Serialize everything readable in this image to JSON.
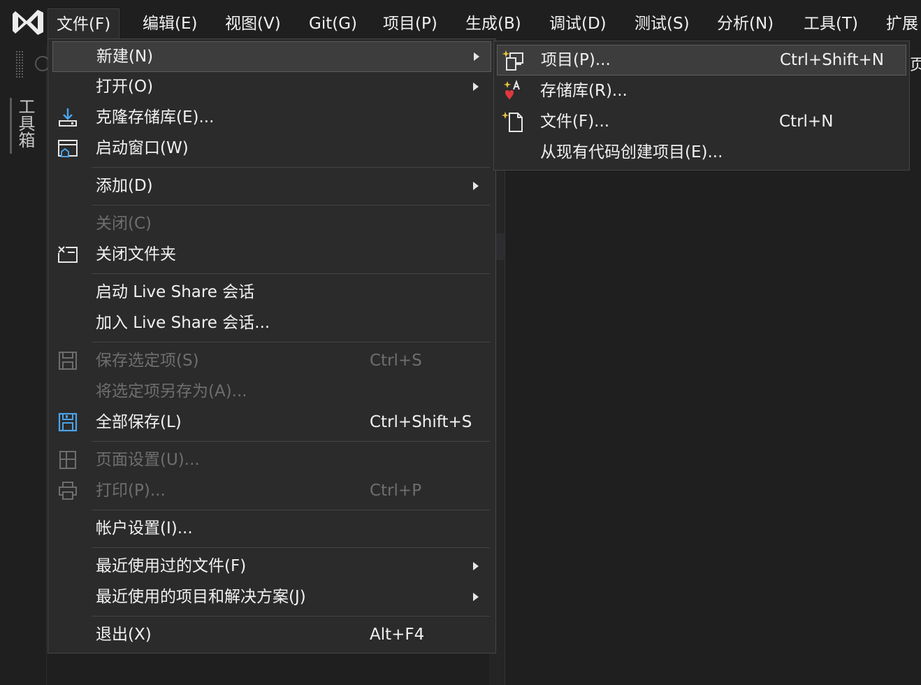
{
  "menubar": {
    "logo_icon": "visual-studio-logo-icon",
    "items": [
      {
        "label": "文件(F)"
      },
      {
        "label": "编辑(E)"
      },
      {
        "label": "视图(V)"
      },
      {
        "label": "Git(G)"
      },
      {
        "label": "项目(P)"
      },
      {
        "label": "生成(B)"
      },
      {
        "label": "调试(D)"
      },
      {
        "label": "测试(S)"
      },
      {
        "label": "分析(N)"
      },
      {
        "label": "工具(T)"
      },
      {
        "label": "扩展"
      }
    ]
  },
  "left_strip": {
    "toolbox_label": "工具箱"
  },
  "edge_text": "页",
  "file_menu": {
    "new": {
      "label": "新建(N)"
    },
    "open": {
      "label": "打开(O)"
    },
    "clone": {
      "label": "克隆存储库(E)...",
      "icon": "clone-download-icon"
    },
    "start_window": {
      "label": "启动窗口(W)",
      "icon": "start-window-icon"
    },
    "add": {
      "label": "添加(D)"
    },
    "close": {
      "label": "关闭(C)"
    },
    "close_folder": {
      "label": "关闭文件夹",
      "icon": "close-folder-icon"
    },
    "start_liveshare": {
      "label": "启动 Live Share 会话"
    },
    "join_liveshare": {
      "label": "加入 Live Share 会话..."
    },
    "save_selected": {
      "label": "保存选定项(S)",
      "shortcut": "Ctrl+S",
      "icon": "save-icon"
    },
    "save_as": {
      "label": "将选定项另存为(A)..."
    },
    "save_all": {
      "label": "全部保存(L)",
      "shortcut": "Ctrl+Shift+S",
      "icon": "save-all-icon"
    },
    "page_setup": {
      "label": "页面设置(U)...",
      "icon": "page-setup-icon"
    },
    "print": {
      "label": "打印(P)...",
      "shortcut": "Ctrl+P",
      "icon": "print-icon"
    },
    "account": {
      "label": "帐户设置(I)..."
    },
    "recent_files": {
      "label": "最近使用过的文件(F)"
    },
    "recent_projects": {
      "label": "最近使用的项目和解决方案(J)"
    },
    "exit": {
      "label": "退出(X)",
      "shortcut": "Alt+F4"
    }
  },
  "new_submenu": {
    "project": {
      "label": "项目(P)...",
      "shortcut": "Ctrl+Shift+N",
      "icon": "new-project-icon"
    },
    "repository": {
      "label": "存储库(R)...",
      "icon": "new-repository-icon"
    },
    "file": {
      "label": "文件(F)...",
      "shortcut": "Ctrl+N",
      "icon": "new-file-icon"
    },
    "from_existing": {
      "label": "从现有代码创建项目(E)..."
    }
  },
  "colors": {
    "background": "#1f1f1f",
    "menu_bg": "#2b2b2b",
    "highlight": "#3d3d3d",
    "accent_blue": "#4aa3e8",
    "disabled": "#6e6e6e"
  }
}
